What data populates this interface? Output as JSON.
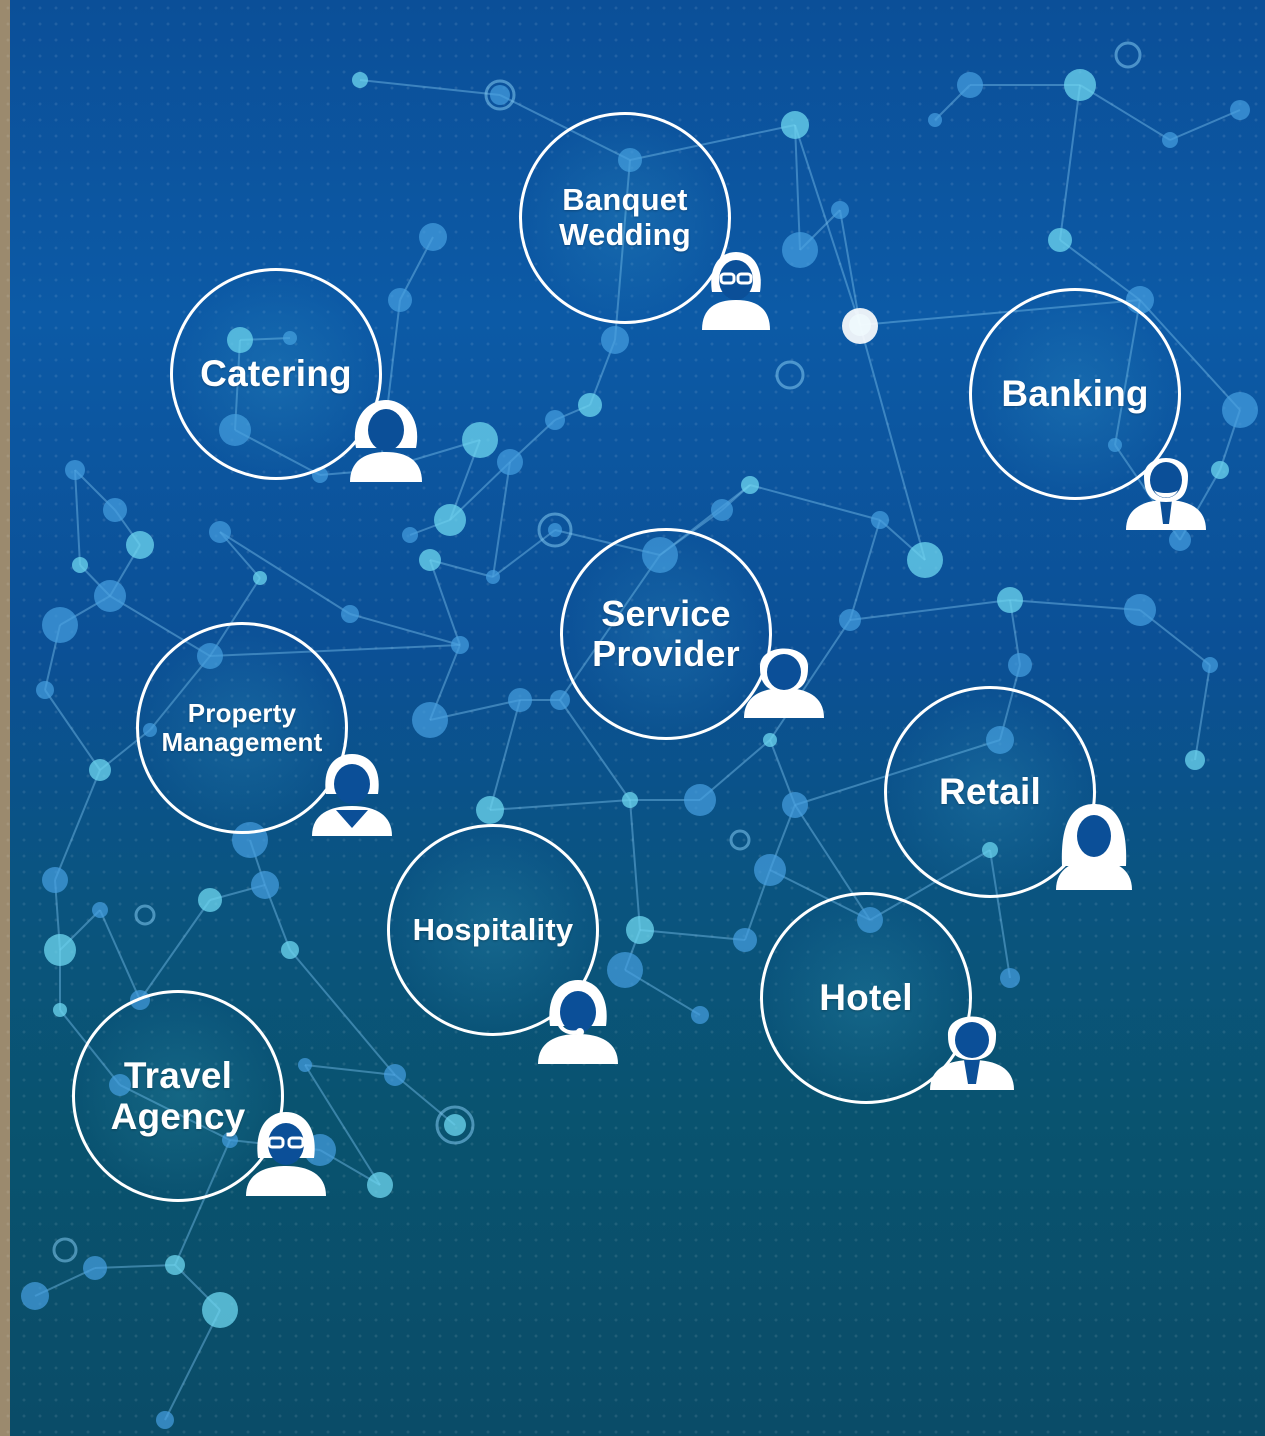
{
  "banner": {
    "text": ""
  },
  "nodes": [
    {
      "id": "banquet-wedding",
      "label": "Banquet Wedding",
      "person_icon": "woman-glasses-icon"
    },
    {
      "id": "catering",
      "label": "Catering",
      "person_icon": "woman-icon"
    },
    {
      "id": "banking",
      "label": "Banking",
      "person_icon": "man-beard-tie-icon"
    },
    {
      "id": "service-provider",
      "label": "Service Provider",
      "person_icon": "man-icon"
    },
    {
      "id": "property-management",
      "label": "Property Management",
      "person_icon": "woman-scarf-icon"
    },
    {
      "id": "retail",
      "label": "Retail",
      "person_icon": "woman-long-hair-icon"
    },
    {
      "id": "hospitality",
      "label": "Hospitality",
      "person_icon": "woman-headset-icon"
    },
    {
      "id": "hotel",
      "label": "Hotel",
      "person_icon": "man-tie-icon"
    },
    {
      "id": "travel-agency",
      "label": "Travel Agency",
      "person_icon": "woman-glasses-icon"
    }
  ],
  "colors": {
    "background_top": "#0b4f98",
    "background_bottom": "#0a4c68",
    "node_ring": "#ffffff",
    "network_dot": "#5bc8e6"
  }
}
